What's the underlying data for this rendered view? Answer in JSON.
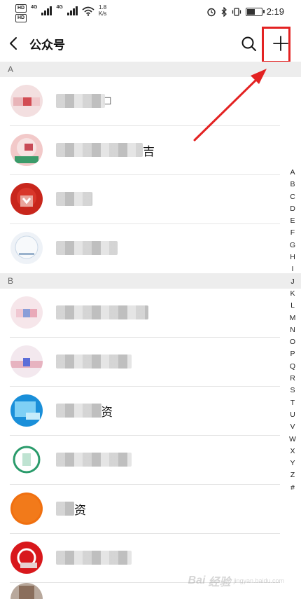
{
  "status_bar": {
    "hd1": "HD",
    "hd2": "HD",
    "net1": "4G",
    "net2": "4G",
    "speed_value": "1.8",
    "speed_unit": "K/s",
    "time": "2:19",
    "battery_level": 0.6
  },
  "header": {
    "title": "公众号"
  },
  "sections": [
    {
      "letter": "A"
    },
    {
      "letter": "B"
    }
  ],
  "accounts": [
    {
      "suffix": "",
      "avatar_color": "#e8b4b8",
      "avatar_accent": "#ffffff"
    },
    {
      "suffix": "吉",
      "avatar_color": "#f2c9c9",
      "avatar_accent": "#3b9b6a"
    },
    {
      "suffix": "",
      "avatar_color": "#c8261c",
      "avatar_accent": "#f0d070"
    },
    {
      "suffix": "",
      "avatar_color": "#e9eef5",
      "avatar_accent": "#7aa3c9"
    },
    {
      "suffix": "",
      "avatar_color": "#f6dde2",
      "avatar_accent": "#8a9ed8"
    },
    {
      "suffix": "",
      "avatar_color": "#f3e6ec",
      "avatar_accent": "#6d7ad8"
    },
    {
      "suffix": "资",
      "avatar_color": "#1a8fd9",
      "avatar_accent": "#7fd0f5"
    },
    {
      "suffix": "",
      "avatar_color": "#ffffff",
      "avatar_accent": "#2a9b6b"
    },
    {
      "suffix": "资",
      "avatar_color": "#f07010",
      "avatar_accent": "#f5a040"
    },
    {
      "suffix": "",
      "avatar_color": "#d8181c",
      "avatar_accent": "#ffffff"
    }
  ],
  "index_letters": [
    "A",
    "B",
    "C",
    "D",
    "E",
    "F",
    "G",
    "H",
    "I",
    "J",
    "K",
    "L",
    "M",
    "N",
    "O",
    "P",
    "Q",
    "R",
    "S",
    "T",
    "U",
    "V",
    "W",
    "X",
    "Y",
    "Z",
    "#"
  ],
  "watermark": {
    "brand": "Bai",
    "brand2": "经验",
    "sub": "jingyan.baidu.com"
  },
  "colors": {
    "highlight": "#e32222",
    "section_bg": "#ededed",
    "divider": "#e5e5e5"
  }
}
